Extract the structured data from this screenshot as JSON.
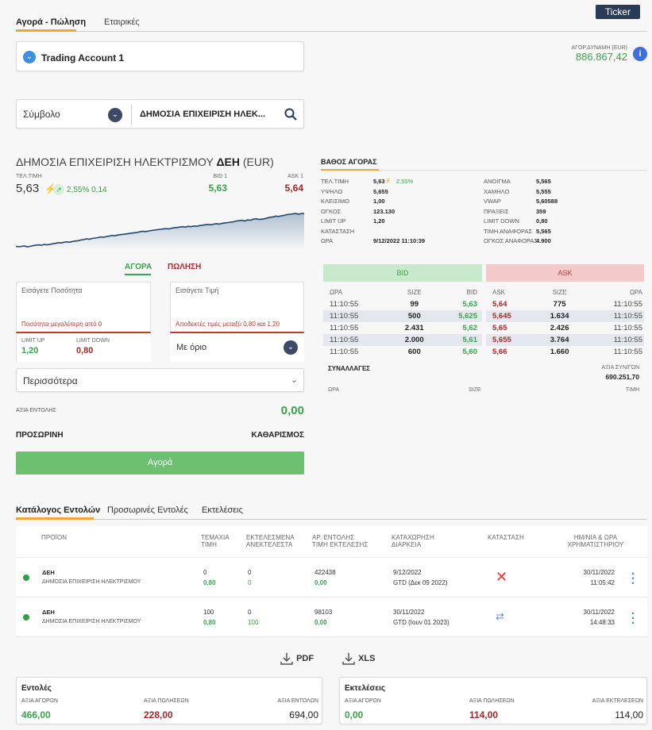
{
  "top_tabs": [
    "Αγορά - Πώληση",
    "Εταιρικές"
  ],
  "ticker_label": "Ticker",
  "account": {
    "name": "Trading Account 1"
  },
  "buying_power": {
    "label": "ΑΓΟΡ.ΔΥΝΑΜΗ (EUR)",
    "value": "886.867,42"
  },
  "symbol": {
    "placeholder": "Σύμβολο",
    "value": "ΔΗΜΟΣΙΑ ΕΠΙΧΕΙΡΙΣΗ ΗΛΕΚ..."
  },
  "instrument": {
    "name": "ΔΗΜΟΣΙΑ ΕΠΙΧΕΙΡΙΣΗ ΗΛΕΚΤΡΙΣΜΟΥ",
    "code": "ΔΕΗ",
    "currency": "(EUR)",
    "last_label": "ΤΕΛ.ΤΙΜΗ",
    "last": "5,63",
    "change": "2,55% 0,14",
    "bid1_label": "BID 1",
    "bid1": "5,63",
    "ask1_label": "ASK 1",
    "ask1": "5,64"
  },
  "sparkline": [
    13,
    12,
    13,
    14,
    12,
    13,
    15,
    16,
    17,
    16,
    18,
    17,
    18,
    20,
    21,
    23,
    22,
    24,
    25,
    24,
    26,
    27,
    28,
    30,
    31,
    33,
    32,
    34,
    35,
    36,
    38,
    37,
    39,
    40,
    42,
    41,
    43,
    44,
    45,
    46,
    47,
    48,
    49,
    50,
    52,
    53,
    52,
    54,
    55,
    56,
    57,
    58,
    59,
    60,
    59,
    61,
    62,
    63,
    64,
    65,
    64,
    66,
    65,
    67,
    66,
    68,
    69,
    70,
    71,
    70,
    72,
    73,
    72,
    74,
    75,
    76,
    77,
    78,
    80,
    81,
    82,
    80,
    83,
    82,
    85,
    86,
    84,
    85,
    86,
    88,
    90,
    91,
    93,
    92,
    94,
    95,
    97,
    98,
    99,
    100,
    98,
    100,
    100
  ],
  "order_tabs": {
    "buy": "ΑΓΟΡΑ",
    "sell": "ΠΩΛΗΣΗ"
  },
  "order_form": {
    "quantity_placeholder": "Εισάγετε Ποσότητα",
    "price_placeholder": "Εισάγετε Τιμή",
    "quantity_error": "Ποσότητα μεγαλύτερη από 0",
    "price_error": "Αποδεκτές τιμές μεταξύ 0,80 και 1,20",
    "limit_up_label": "LIMIT UP",
    "limit_up": "1,20",
    "limit_down_label": "LIMIT DOWN",
    "limit_down": "0,80",
    "order_type": "Με όριο",
    "more": "Περισσότερα",
    "order_value_label": "ΑΞΙΑ ΕΝΤΟΛΗΣ",
    "order_value": "0,00",
    "temp_label": "ΠΡΟΣΩΡΙΝΗ",
    "clear_label": "ΚΑΘΑΡΙΣΜΟΣ",
    "submit": "Αγορά"
  },
  "depth": {
    "title": "ΒΑΘΟΣ ΑΓΟΡΑΣ",
    "stats_left": [
      {
        "label": "ΤΕΛ.ΤΙΜΗ",
        "value": "5,63"
      },
      {
        "label": "ΥΨΗΛΟ",
        "value": "5,655"
      },
      {
        "label": "ΚΛΕΙΣΙΜΟ",
        "value": "1,00"
      },
      {
        "label": "ΟΓΚΟΣ",
        "value": "123.130"
      },
      {
        "label": "LIMIT UP",
        "value": "1,20"
      },
      {
        "label": "ΚΑΤΑΣΤΑΣΗ",
        "value": ""
      },
      {
        "label": "ΩΡΑ",
        "value": "9/12/2022 11:10:39"
      }
    ],
    "last_change": "2,55%",
    "stats_right": [
      {
        "label": "ΑΝΟΙΓΜΑ",
        "value": "5,565"
      },
      {
        "label": "ΧΑΜΗΛΟ",
        "value": "5,555"
      },
      {
        "label": "VWAP",
        "value": "5,60588"
      },
      {
        "label": "ΠΡΑΞΕΙΣ",
        "value": "359"
      },
      {
        "label": "LIMIT DOWN",
        "value": "0,80"
      },
      {
        "label": "ΤΙΜΗ ΑΝΑΦΟΡΑΣ",
        "value": "5,565"
      },
      {
        "label": "ΟΓΚΟΣ ΑΝΑΦΟΡΑΣ",
        "value": "4.900"
      }
    ],
    "bid_header": "BID",
    "ask_header": "ASK",
    "bid_cols": [
      "ΩΡΑ",
      "SIZE",
      "BID"
    ],
    "ask_cols": [
      "ASK",
      "SIZE",
      "ΩΡΑ"
    ],
    "bids": [
      {
        "time": "11:10:55",
        "size": "99",
        "price": "5,63"
      },
      {
        "time": "11:10:55",
        "size": "500",
        "price": "5,625"
      },
      {
        "time": "11:10:55",
        "size": "2.431",
        "price": "5,62"
      },
      {
        "time": "11:10:55",
        "size": "2.000",
        "price": "5,61"
      },
      {
        "time": "11:10:55",
        "size": "600",
        "price": "5,60"
      }
    ],
    "asks": [
      {
        "price": "5,64",
        "size": "775",
        "time": "11:10:55"
      },
      {
        "price": "5,645",
        "size": "1.634",
        "time": "11:10:55"
      },
      {
        "price": "5,65",
        "size": "2.426",
        "time": "11:10:55"
      },
      {
        "price": "5,655",
        "size": "3.764",
        "time": "11:10:55"
      },
      {
        "price": "5,66",
        "size": "1.660",
        "time": "11:10:55"
      }
    ],
    "trades_title": "ΣΥΝΑΛΛΑΓΕΣ",
    "trades_value_label": "ΑΞΙΑ ΣΥΝ/ΓΩΝ",
    "trades_value": "690.251,70",
    "trades_cols": [
      "ΩΡΑ",
      "SIZE",
      "ΤΙΜΗ"
    ]
  },
  "orders": {
    "tabs": [
      "Κατάλογος Εντολών",
      "Προσωρινές Εντολές",
      "Εκτελέσεις"
    ],
    "headers": [
      [
        "ΠΡΟΪΟΝ",
        ""
      ],
      [
        "ΤΕΜΑΧΙΑ",
        "ΤΙΜΗ"
      ],
      [
        "ΕΚΤΕΛΕΣΜΕΝΑ",
        "ΑΝΕΚΤΕΛΕΣΤΑ"
      ],
      [
        "ΑΡ. ΕΝΤΟΛΗΣ",
        "ΤΙΜΗ ΕΚΤΕΛΕΣΗΣ"
      ],
      [
        "ΚΑΤΑΧΩΡΗΣΗ",
        "ΔΙΑΡΚΕΙΑ"
      ],
      [
        "ΚΑΤΑΣΤΑΣΗ",
        ""
      ],
      [
        "ΗΜ/ΝΙΑ & ΩΡΑ",
        "ΧΡΗΜΑΤΙΣΤΗΡΙΟΥ"
      ]
    ],
    "rows": [
      {
        "code": "ΔΕΗ",
        "name": "ΔΗΜΟΣΙΑ ΕΠΙΧΕΙΡΙΣΗ ΗΛΕΚΤΡΙΣΜΟΥ",
        "qty": "0",
        "price": "0,80",
        "exec": "0",
        "unexec": "0",
        "order_no": "422438",
        "exec_price": "0,00",
        "reg": "9/12/2022",
        "duration": "GTD (Δεκ 09 2022)",
        "status": "cancelled",
        "date": "30/11/2022",
        "time": "11:05:42"
      },
      {
        "code": "ΔΕΗ",
        "name": "ΔΗΜΟΣΙΑ ΕΠΙΧΕΙΡΙΣΗ ΗΛΕΚΤΡΙΣΜΟΥ",
        "qty": "100",
        "price": "0,80",
        "exec": "0",
        "unexec": "100",
        "order_no": "98103",
        "exec_price": "0,00",
        "reg": "30/11/2022",
        "duration": "GTD (Ιουν 01 2023)",
        "status": "modified",
        "date": "30/11/2022",
        "time": "14:48:33"
      }
    ],
    "export_pdf": "PDF",
    "export_xls": "XLS"
  },
  "summary": {
    "orders_title": "Εντολές",
    "executions_title": "Εκτελέσεις",
    "buy_value_label": "ΑΞΙΑ ΑΓΟΡΩΝ",
    "sell_value_label": "ΑΞΙΑ ΠΩΛΗΣΕΩΝ",
    "order_value_label": "ΑΞΙΑ ΕΝΤΟΛΩΝ",
    "exec_value_label": "ΑΞΙΑ ΕΚΤΕΛΕΣΕΩΝ",
    "orders_buy": "466,00",
    "orders_sell": "228,00",
    "orders_total": "694,00",
    "exec_buy": "0,00",
    "exec_sell": "114,00",
    "exec_total": "114,00"
  },
  "colors": {
    "green": "#3aa24a",
    "red": "#c0392b",
    "accent": "#f0a53a",
    "blue": "#3d8fe0",
    "buy_button": "#6cc070"
  }
}
